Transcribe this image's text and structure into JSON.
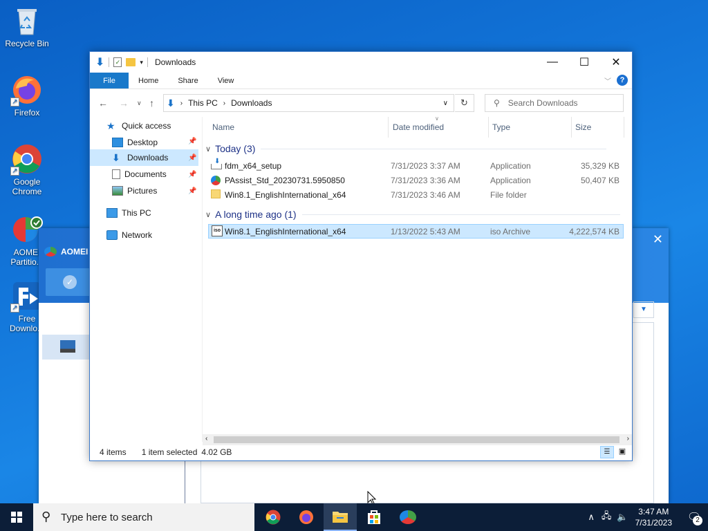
{
  "desktop": {
    "icons": [
      {
        "label": "Recycle Bin"
      },
      {
        "label": "Firefox"
      },
      {
        "label": "Google Chrome"
      },
      {
        "label": "AOMEI Partitio..."
      },
      {
        "label": "Free Downlo..."
      }
    ]
  },
  "aomei": {
    "title": "AOMEI"
  },
  "explorer": {
    "title": "Downloads",
    "ribbon": {
      "file": "File",
      "home": "Home",
      "share": "Share",
      "view": "View",
      "help": "?"
    },
    "breadcrumb": {
      "root": "This PC",
      "current": "Downloads"
    },
    "search_placeholder": "Search Downloads",
    "nav": {
      "quick_access": "Quick access",
      "desktop": "Desktop",
      "downloads": "Downloads",
      "documents": "Documents",
      "pictures": "Pictures",
      "this_pc": "This PC",
      "network": "Network"
    },
    "columns": {
      "name": "Name",
      "date": "Date modified",
      "type": "Type",
      "size": "Size"
    },
    "groups": [
      {
        "label": "Today (3)",
        "files": [
          {
            "name": "fdm_x64_setup",
            "date": "7/31/2023 3:37 AM",
            "type": "Application",
            "size": "35,329 KB"
          },
          {
            "name": "PAssist_Std_20230731.5950850",
            "date": "7/31/2023 3:36 AM",
            "type": "Application",
            "size": "50,407 KB"
          },
          {
            "name": "Win8.1_EnglishInternational_x64",
            "date": "7/31/2023 3:46 AM",
            "type": "File folder",
            "size": ""
          }
        ]
      },
      {
        "label": "A long time ago (1)",
        "files": [
          {
            "name": "Win8.1_EnglishInternational_x64",
            "date": "1/13/2022 5:43 AM",
            "type": "iso Archive",
            "size": "4,222,574 KB"
          }
        ]
      }
    ],
    "status": {
      "items": "4 items",
      "selected": "1 item selected",
      "size": "4.02 GB"
    }
  },
  "taskbar": {
    "search_placeholder": "Type here to search",
    "time": "3:47 AM",
    "date": "7/31/2023",
    "notifications": "2"
  },
  "colors": {
    "accent": "#1979ca",
    "selection": "#cce8ff",
    "taskbar": "#0c1e38"
  }
}
